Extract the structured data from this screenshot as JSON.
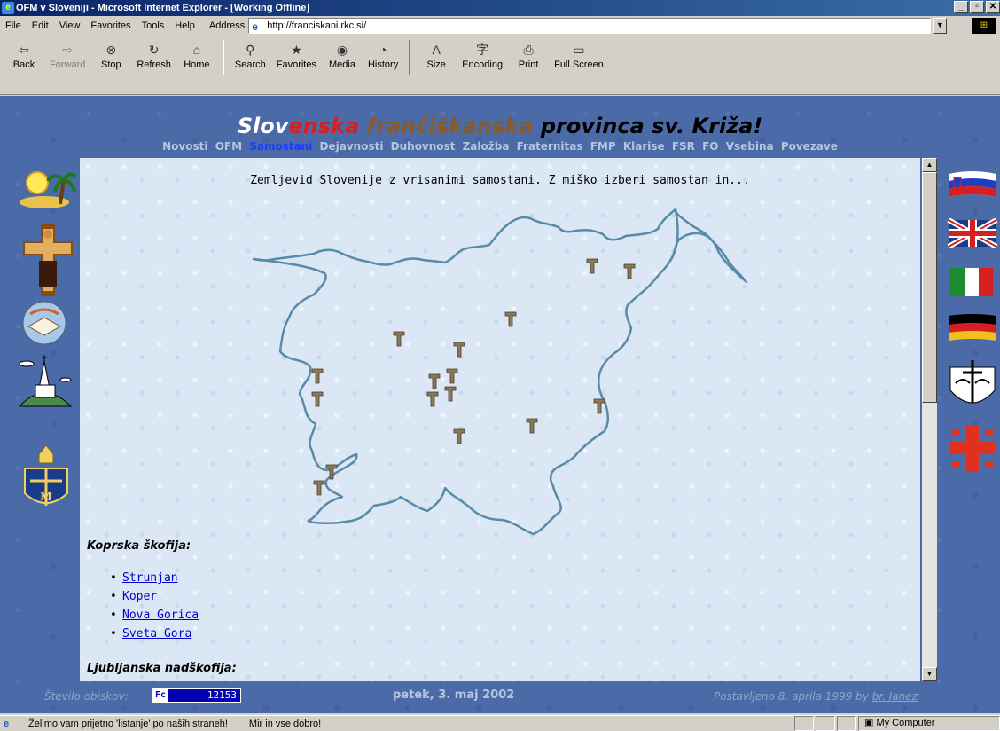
{
  "window": {
    "title": "OFM v Sloveniji - Microsoft Internet Explorer - [Working Offline]",
    "buttons": [
      "_",
      "▫",
      "✕"
    ]
  },
  "menu": [
    "File",
    "Edit",
    "View",
    "Favorites",
    "Tools",
    "Help"
  ],
  "address": {
    "label": "Address",
    "url": "http://franciskani.rkc.si/"
  },
  "toolbar": [
    {
      "label": "Back",
      "icon": "⇦",
      "enabled": true
    },
    {
      "label": "Forward",
      "icon": "⇨",
      "enabled": false
    },
    {
      "label": "Stop",
      "icon": "⊗",
      "enabled": true
    },
    {
      "label": "Refresh",
      "icon": "↻",
      "enabled": true
    },
    {
      "label": "Home",
      "icon": "⌂",
      "enabled": true
    },
    {
      "label": "Search",
      "icon": "⚲",
      "enabled": true
    },
    {
      "label": "Favorites",
      "icon": "★",
      "enabled": true
    },
    {
      "label": "Media",
      "icon": "◉",
      "enabled": true
    },
    {
      "label": "History",
      "icon": "◔",
      "enabled": true
    },
    {
      "label": "Size",
      "icon": "A",
      "enabled": true
    },
    {
      "label": "Encoding",
      "icon": "字",
      "enabled": true
    },
    {
      "label": "Print",
      "icon": "⎙",
      "enabled": true
    },
    {
      "label": "Full Screen",
      "icon": "▭",
      "enabled": true
    }
  ],
  "site": {
    "title_parts": [
      "Slov",
      "enska",
      " frančiškanska",
      " provinca sv. Križa!"
    ],
    "nav": [
      "Novosti",
      "OFM",
      "Samostani",
      "Dejavnosti",
      "Duhovnost",
      "Založba",
      "Fraternitas",
      "FMP",
      "Klarise",
      "FSR",
      "FO",
      "Vsebina",
      "Povezave"
    ],
    "nav_active": "Samostani",
    "map_caption": "Zemljevid Slovenije z vrisanimi samostani. Z miško izberi samostan in...",
    "dioceses": [
      {
        "name": "Koprska škofija:",
        "links": [
          "Strunjan",
          "Koper",
          "Nova Gorica",
          "Sveta Gora"
        ]
      },
      {
        "name": "Ljubljanska nadškofija:",
        "links": []
      }
    ]
  },
  "footer": {
    "visits_label": "Število obiskov:",
    "counter_badge": "Fc",
    "counter_value": "12153",
    "date": "petek, 3. maj 2002",
    "posted": "Postavljeno 8. aprila 1999 by",
    "author": "br. Janez"
  },
  "status": {
    "message": "Želimo vam prijetno 'listanje' po naših straneh!",
    "message2": "Mir in vse dobro!",
    "zone": "My Computer"
  },
  "colors": {
    "page_bg": "#4a6aa8",
    "content_bg": "#dbe7f4",
    "link": "#0000cc",
    "active_nav": "#1a3aff"
  }
}
